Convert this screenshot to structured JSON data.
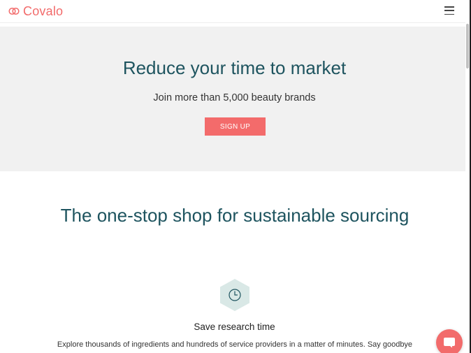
{
  "header": {
    "brand": "Covalo"
  },
  "hero": {
    "title": "Reduce your time to market",
    "subtitle": "Join more than 5,000 beauty brands",
    "cta_label": "SIGN UP"
  },
  "section": {
    "title": "The one-stop shop for sustainable sourcing",
    "feature": {
      "icon": "clock-icon",
      "title": "Save research time",
      "description": "Explore thousands of ingredients and hundreds of service providers in a matter of minutes. Say goodbye"
    }
  },
  "chat": {
    "icon": "chat-icon"
  },
  "colors": {
    "brand": "#f26b6b",
    "heading": "#1e545f",
    "hero_bg": "#f1f1f1"
  }
}
